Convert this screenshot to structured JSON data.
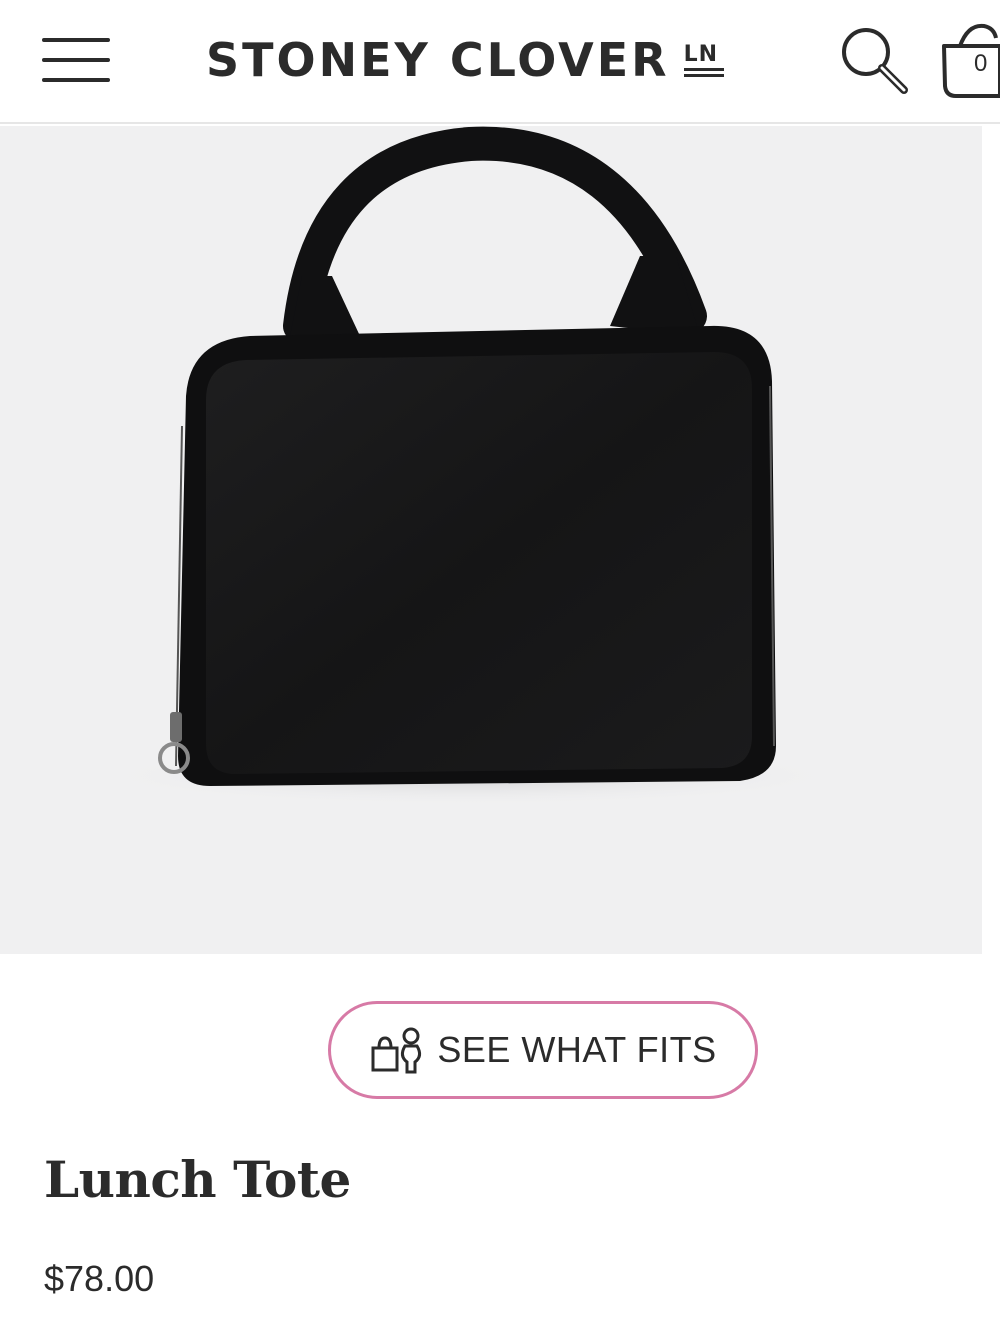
{
  "header": {
    "logo_text": "STONEY CLOVER",
    "logo_mark": "LN",
    "cart_count": "0",
    "icons": {
      "menu": "hamburger-menu-icon",
      "search": "search-icon",
      "cart": "shopping-basket-icon"
    }
  },
  "product": {
    "image": "black-lunch-tote-bag",
    "see_what_fits_label": "SEE WHAT FITS",
    "fits_icon": "bag-and-person-icon",
    "title": "Lunch Tote",
    "price": "$78.00"
  },
  "colors": {
    "accent_border": "#d77aa6",
    "text": "#2b2b2b",
    "image_background": "#f0f0f1"
  }
}
